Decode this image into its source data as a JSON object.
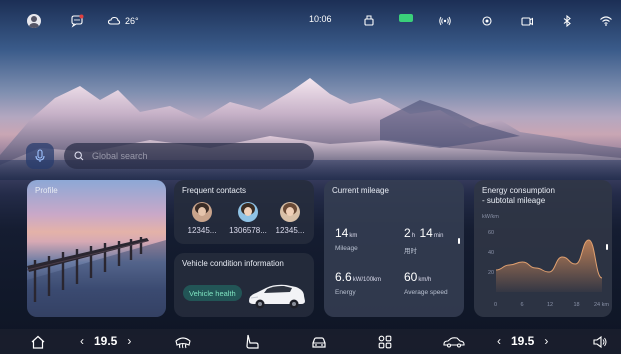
{
  "status_bar": {
    "weather_icon": "cloud-icon",
    "temperature": "26°",
    "time": "10:06",
    "battery_color": "#3ad07a",
    "notification_color": "#e04040"
  },
  "search": {
    "placeholder": "Global search"
  },
  "cards": {
    "profile": {
      "title": "Profile"
    },
    "contacts": {
      "title": "Frequent contacts",
      "items": [
        {
          "number": "12345..."
        },
        {
          "number": "1306578..."
        },
        {
          "number": "12345..."
        }
      ]
    },
    "vehicle": {
      "title": "Vehicle condition information",
      "badge": "Vehicle health",
      "badge_color": "#7fe5c2"
    },
    "mileage": {
      "title": "Current mileage",
      "distance": {
        "value": "14",
        "unit": "km",
        "label": "Mileage"
      },
      "duration": {
        "hours": "2",
        "hours_unit": "h",
        "minutes": "14",
        "minutes_unit": "min",
        "label": "用时"
      },
      "energy": {
        "value": "6.6",
        "unit": "kW/100km",
        "label": "Energy"
      },
      "speed": {
        "value": "60",
        "unit": "km/h",
        "label": "Average speed"
      }
    },
    "energy": {
      "title_line1": "Energy consumption",
      "title_line2": "- subtotal mileage",
      "unit": "kW/km",
      "y_ticks": [
        "60",
        "40",
        "20"
      ],
      "x_ticks": [
        "0",
        "6",
        "12",
        "18",
        "24 km"
      ]
    }
  },
  "chart_data": {
    "type": "area",
    "x": [
      0,
      3,
      6,
      9,
      12,
      15,
      18,
      21,
      24
    ],
    "values": [
      22,
      27,
      30,
      24,
      20,
      35,
      28,
      52,
      14
    ],
    "ylim": [
      0,
      70
    ],
    "xlim": [
      0,
      24
    ],
    "xlabel": "",
    "ylabel": "kW/km",
    "color": "#d08a5a"
  },
  "dock": {
    "left_temp": "19.5",
    "right_temp": "19.5",
    "icons": [
      "home-icon",
      "defrost-icon",
      "seat-icon",
      "car-icon",
      "apps-grid-icon",
      "car-side-icon",
      "volume-icon"
    ]
  }
}
